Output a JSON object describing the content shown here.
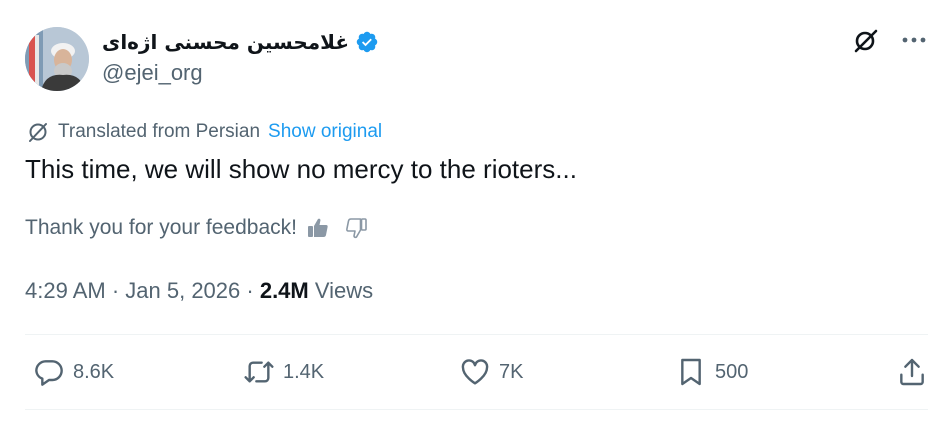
{
  "author": {
    "display_name": "غلامحسین محسنی اژه‌ای",
    "handle": "@ejei_org",
    "verified_color": "#1d9bf0",
    "avatar_icon": "avatar-photo"
  },
  "header_actions": {
    "grok_icon": "grok-icon",
    "more_icon": "more-icon"
  },
  "translation": {
    "label": "Translated from Persian",
    "show_original": "Show original",
    "icon": "translate-icon"
  },
  "tweet": {
    "text": "This time, we will show no mercy to the rioters..."
  },
  "feedback": {
    "text": "Thank you for your feedback!",
    "thumbs_up_icon": "thumbs-up-icon",
    "thumbs_down_icon": "thumbs-down-icon"
  },
  "meta": {
    "time": "4:29 AM",
    "separator": " · ",
    "date": "Jan 5, 2026",
    "views_count": "2.4M",
    "views_label": " Views"
  },
  "actions": {
    "reply_count": "8.6K",
    "repost_count": "1.4K",
    "like_count": "7K",
    "bookmark_count": "500"
  },
  "colors": {
    "accent": "#1d9bf0",
    "text_primary": "#0f1419",
    "text_secondary": "#536471",
    "divider": "#eff3f4"
  }
}
